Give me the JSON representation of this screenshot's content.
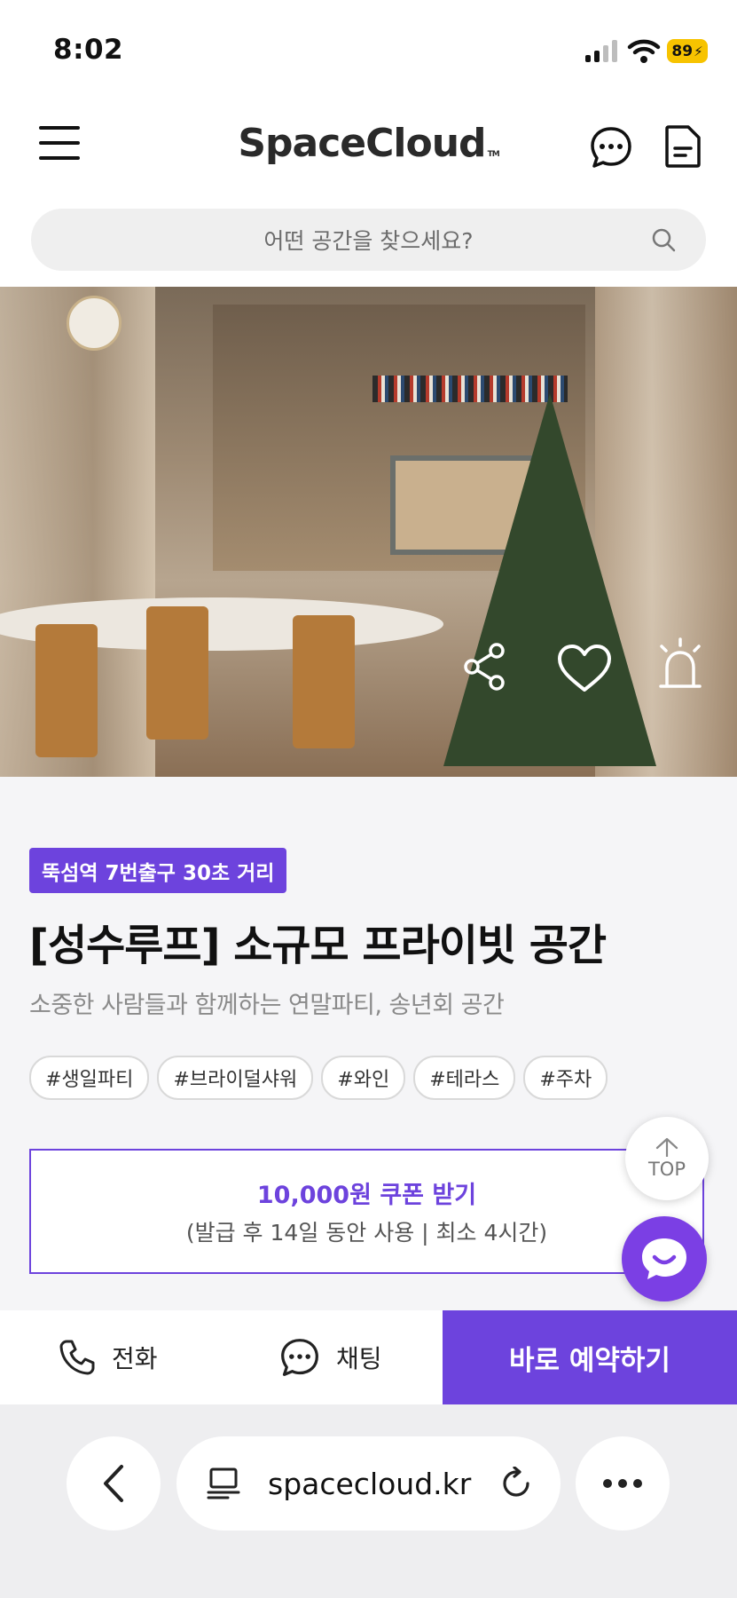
{
  "status_bar": {
    "time": "8:02",
    "battery": "89"
  },
  "header": {
    "logo": "SpaceCloud",
    "logo_tm": "TM"
  },
  "search": {
    "placeholder": "어떤 공간을 찾으세요?"
  },
  "hero": {
    "actions": [
      "share-icon",
      "heart-icon",
      "alarm-icon"
    ]
  },
  "space": {
    "location_badge": "뚝섬역 7번출구 30초 거리",
    "title": "[성수루프] 소규모 프라이빗 공간",
    "subtitle": "소중한 사람들과 함께하는 연말파티, 송년회 공간",
    "tags": [
      "#생일파티",
      "#브라이덜샤워",
      "#와인",
      "#테라스",
      "#주차"
    ]
  },
  "coupon": {
    "title": "10,000원 쿠폰 받기",
    "subtitle": "(발급 후 14일 동안 사용 | 최소 4시간)"
  },
  "floating": {
    "top_label": "TOP"
  },
  "action_bar": {
    "call_label": "전화",
    "chat_label": "채팅",
    "reserve_label": "바로 예약하기"
  },
  "browser": {
    "url": "spacecloud.kr"
  },
  "colors": {
    "accent": "#6d43dd",
    "chat_fab": "#7b3fe4",
    "battery": "#f7c300"
  }
}
